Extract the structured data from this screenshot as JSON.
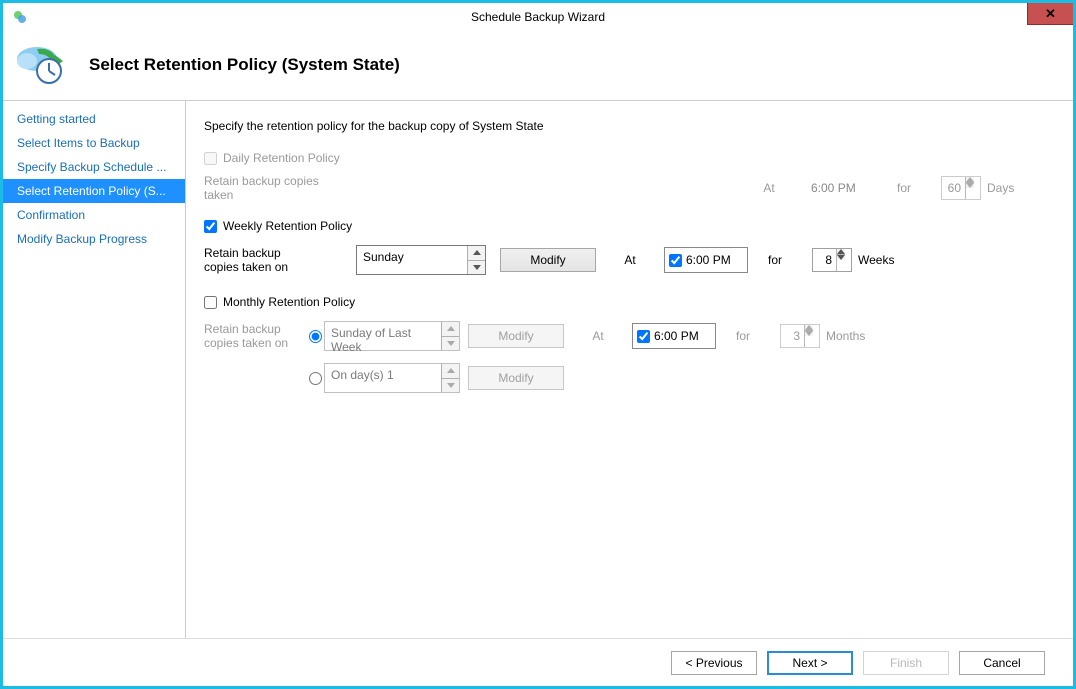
{
  "window": {
    "title": "Schedule Backup Wizard",
    "close": "✕"
  },
  "header": {
    "title": "Select Retention Policy (System State)"
  },
  "sidebar": {
    "steps": [
      "Getting started",
      "Select Items to Backup",
      "Specify Backup Schedule ...",
      "Select Retention Policy (S...",
      "Confirmation",
      "Modify Backup Progress"
    ],
    "active_index": 3
  },
  "content": {
    "instruction": "Specify the retention policy for the backup copy of System State",
    "daily": {
      "label": "Daily Retention Policy",
      "retain_label": "Retain backup copies taken",
      "at_label": "At",
      "time": "6:00 PM",
      "for_label": "for",
      "value": "60",
      "unit": "Days"
    },
    "weekly": {
      "label": "Weekly Retention Policy",
      "retain_label_line1": "Retain backup",
      "retain_label_line2": "copies taken on",
      "day": "Sunday",
      "modify": "Modify",
      "at_label": "At",
      "time": "6:00 PM",
      "for_label": "for",
      "value": "8",
      "unit": "Weeks"
    },
    "monthly": {
      "label": "Monthly Retention Policy",
      "retain_label_line1": "Retain backup",
      "retain_label_line2": "copies taken on",
      "opt1": "Sunday of Last Week",
      "opt2": "On day(s) 1",
      "modify": "Modify",
      "at_label": "At",
      "time": "6:00 PM",
      "for_label": "for",
      "value": "3",
      "unit": "Months"
    }
  },
  "footer": {
    "previous": "< Previous",
    "next": "Next >",
    "finish": "Finish",
    "cancel": "Cancel"
  }
}
